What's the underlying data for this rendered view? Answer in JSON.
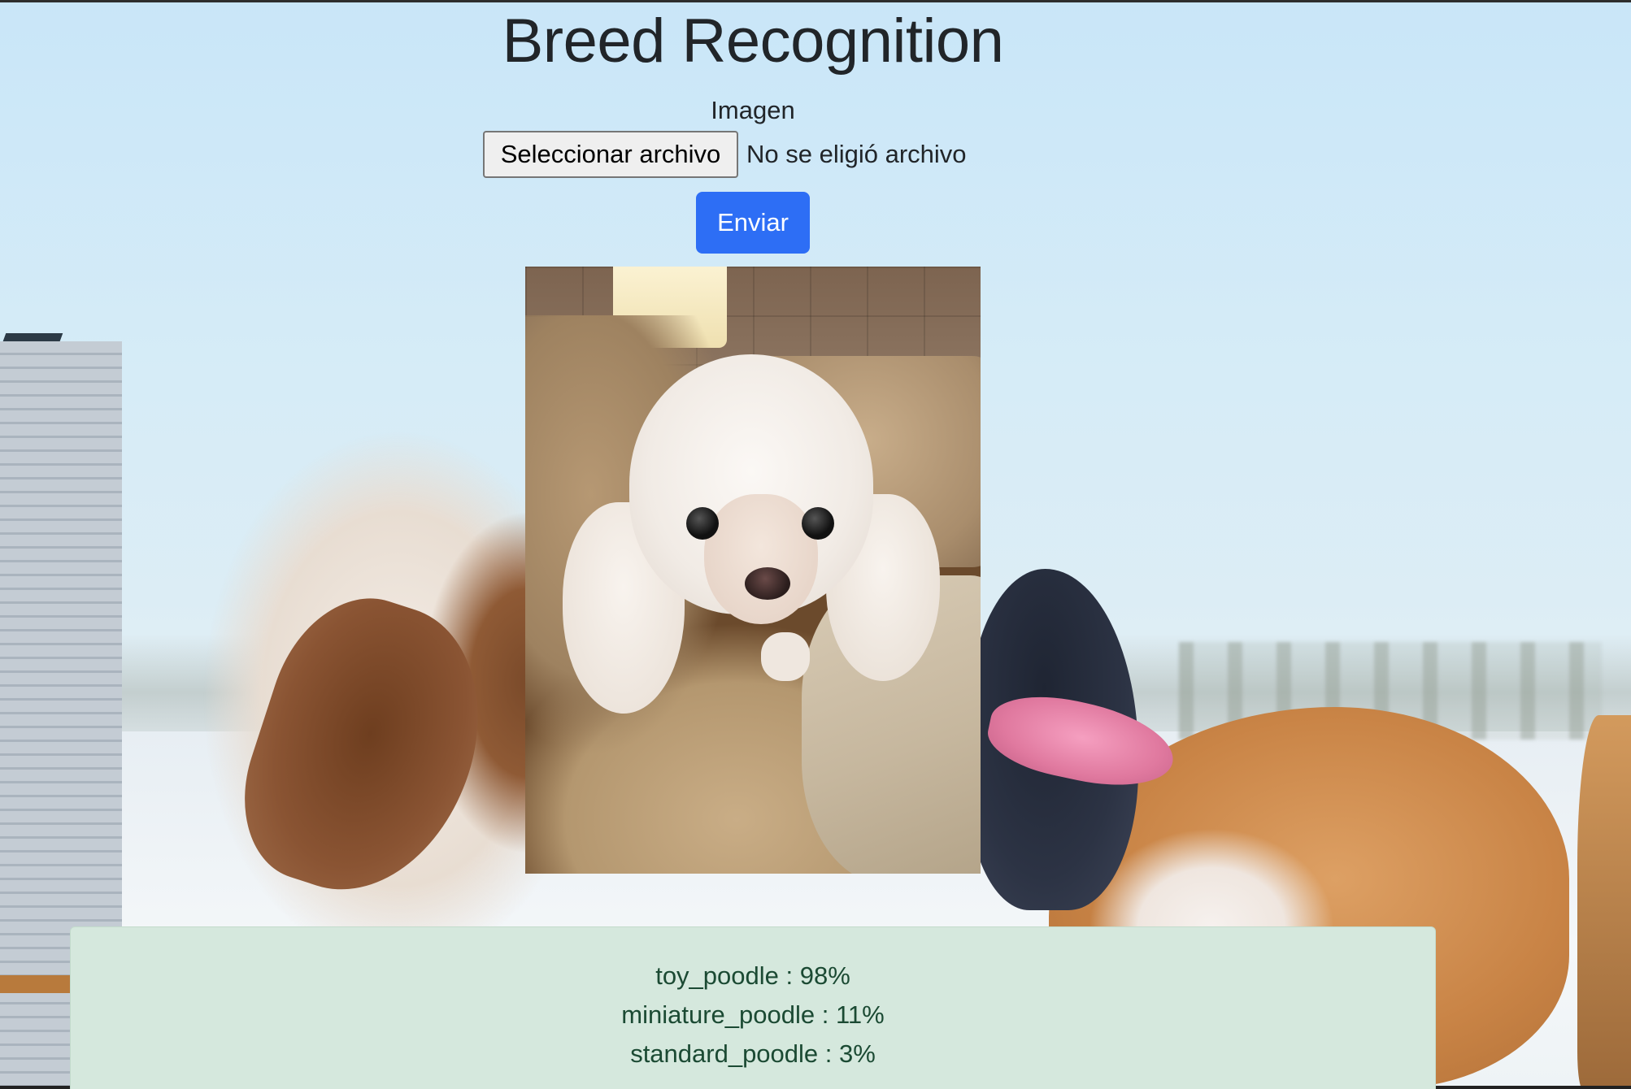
{
  "page": {
    "title": "Breed Recognition"
  },
  "form": {
    "image_label": "Imagen",
    "file_button_label": "Seleccionar archivo",
    "file_status": "No se eligió archivo",
    "submit_label": "Enviar"
  },
  "results": [
    {
      "text": "toy_poodle : 98%"
    },
    {
      "text": "miniature_poodle : 11%"
    },
    {
      "text": "standard_poodle : 3%"
    }
  ],
  "colors": {
    "submit_button": "#2d6ef5",
    "results_panel": "#d5e8dd",
    "results_text": "#1b4a33",
    "title_text": "#212529"
  }
}
